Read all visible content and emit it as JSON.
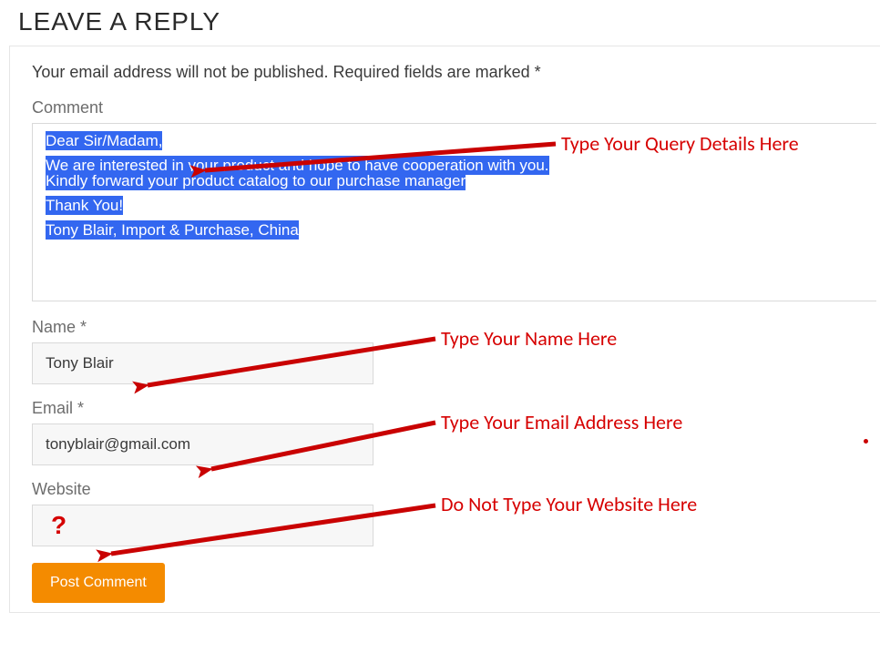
{
  "header": {
    "title": "Leave a Reply"
  },
  "intro": "Your email address will not be published. Required fields are marked *",
  "comment": {
    "label": "Comment",
    "lines": {
      "l1": "Dear Sir/Madam,",
      "l2": "We are interested in your product and hope to have cooperation with you.",
      "l3": "Kindly forward your product catalog to our purchase manager",
      "l4": "Thank You!",
      "l5": "Tony Blair, Import & Purchase, China"
    }
  },
  "name": {
    "label": "Name *",
    "value": "Tony Blair"
  },
  "email": {
    "label": "Email *",
    "value": "tonyblair@gmail.com"
  },
  "website": {
    "label": "Website",
    "marker": "?"
  },
  "submit": {
    "label": "Post Comment"
  },
  "callouts": {
    "c1": "Type Your Query Details Here",
    "c2": "Type Your Name Here",
    "c3": "Type Your Email Address Here",
    "c4": "Do Not Type Your Website Here"
  }
}
